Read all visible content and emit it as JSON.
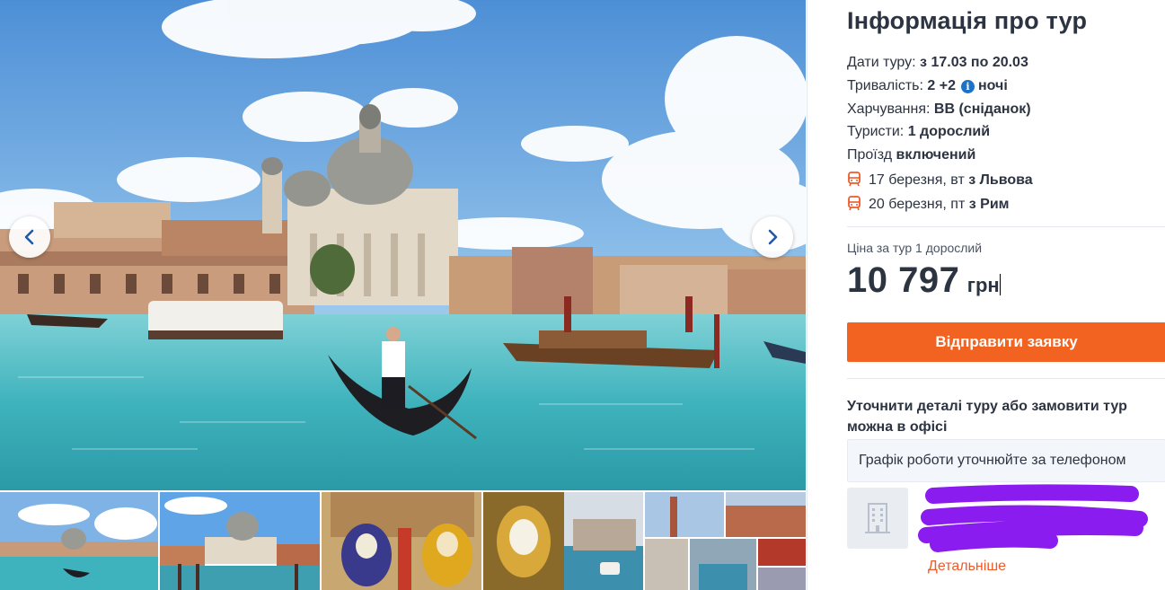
{
  "gallery": {
    "prev_icon": "chevron-left-icon",
    "next_icon": "chevron-right-icon",
    "thumbnail_count": 6
  },
  "tour_info": {
    "title": "Інформація про тур",
    "dates": {
      "label": "Дати туру:",
      "value": "з 17.03 по 20.03"
    },
    "duration": {
      "label": "Тривалість:",
      "value": "2 +2",
      "info_glyph": "i",
      "suffix": "ночі"
    },
    "meals": {
      "label": "Харчування:",
      "value": "BB (сніданок)"
    },
    "tourists": {
      "label": "Туристи:",
      "value": "1 дорослий"
    },
    "transport": {
      "label": "Проїзд",
      "value": "включений"
    },
    "segments": [
      {
        "icon": "bus-icon",
        "date": "17 березня, вт",
        "route": "з Львова"
      },
      {
        "icon": "bus-icon",
        "date": "20 березня, пт",
        "route": "з Рим"
      }
    ]
  },
  "price": {
    "label": "Ціна за тур 1 дорослий",
    "amount": "10 797",
    "currency": "грн"
  },
  "actions": {
    "submit_label": "Відправити заявку"
  },
  "office": {
    "text": "Уточнити деталі туру або замовити тур можна в офісі",
    "schedule": "Графік роботи уточнюйте за телефоном",
    "icon": "building-icon",
    "more_label": "Детальніше"
  },
  "colors": {
    "accent": "#f26322",
    "link": "#ee5a2a",
    "info_blue": "#1a73c9",
    "redaction": "#8a1cf0"
  }
}
